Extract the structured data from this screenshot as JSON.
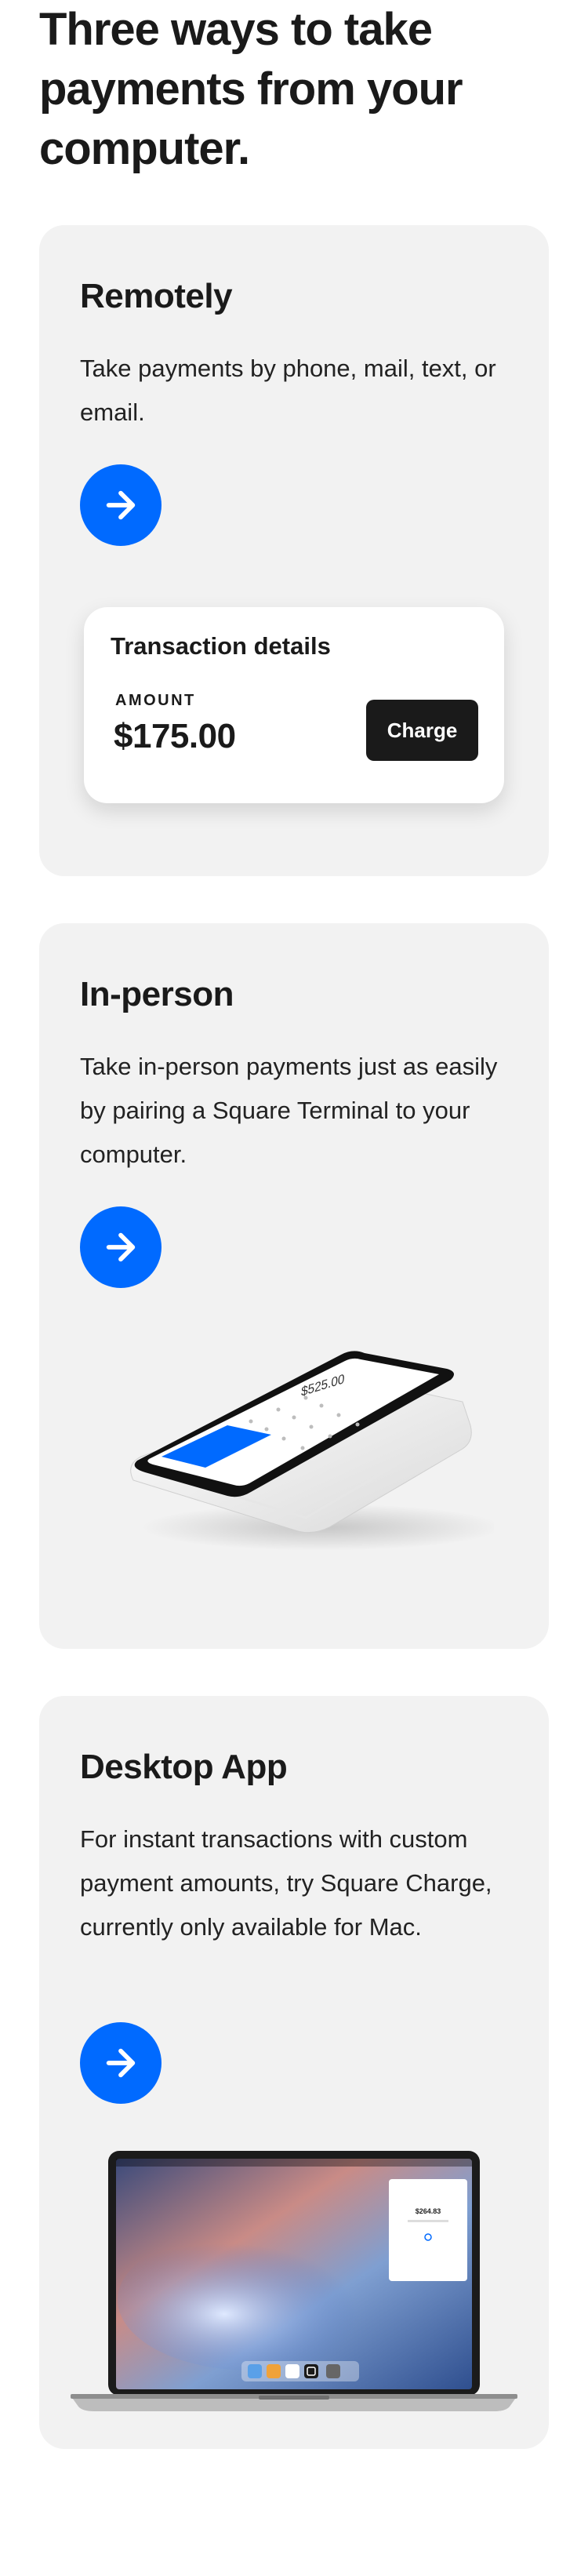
{
  "headline": "Three ways to take payments from your computer.",
  "cards": [
    {
      "title": "Remotely",
      "body": "Take payments by phone, mail, text, or email.",
      "arrow_label": "Learn more about remote payments",
      "widget": {
        "title": "Transaction details",
        "amount_label": "AMOUNT",
        "amount": "$175.00",
        "button": "Charge"
      }
    },
    {
      "title": "In-person",
      "body": "Take in-person payments just as easily by pairing a Square Terminal to your computer.",
      "arrow_label": "Learn more about in-person payments",
      "terminal_amount": "$525.00"
    },
    {
      "title": "Desktop App",
      "body": "For instant transactions with custom payment amounts, try Square Charge, currently only available for Mac.",
      "arrow_label": "Learn more about the desktop app",
      "laptop_amount": "$264.83"
    }
  ],
  "colors": {
    "accent": "#006aff",
    "card_bg": "#f2f2f2",
    "dark_button": "#1a1a1a"
  },
  "icons": {
    "arrow": "arrow-right-icon"
  }
}
